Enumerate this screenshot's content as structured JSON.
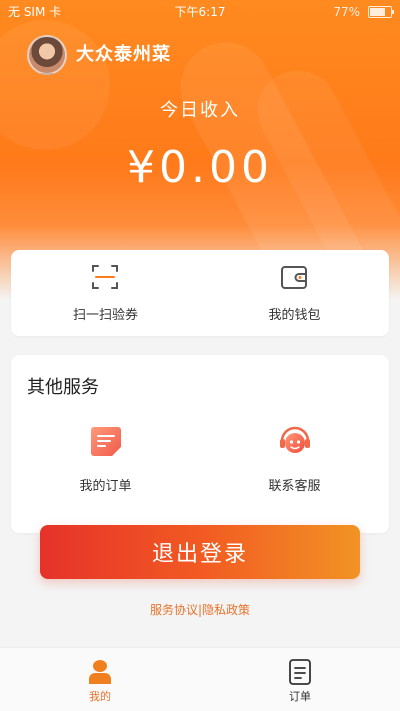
{
  "status_bar": {
    "carrier": "无 SIM 卡",
    "time": "下午6:17",
    "battery": "77%",
    "battery_level": 0.77
  },
  "header": {
    "shop_name": "大众泰州菜",
    "income_label": "今日收入",
    "income_amount": "¥0.00"
  },
  "quick_actions": [
    {
      "label": "扫一扫验券",
      "icon": "scan-icon"
    },
    {
      "label": "我的钱包",
      "icon": "wallet-icon"
    }
  ],
  "services": {
    "title": "其他服务",
    "items": [
      {
        "label": "我的订单",
        "icon": "order-icon"
      },
      {
        "label": "联系客服",
        "icon": "customer-service-icon"
      }
    ]
  },
  "logout_label": "退出登录",
  "links": {
    "agreement": "服务协议",
    "separator": "|",
    "privacy": "隐私政策"
  },
  "tabbar": [
    {
      "label": "我的",
      "icon": "profile-icon",
      "active": true
    },
    {
      "label": "订单",
      "icon": "orders-tab-icon",
      "active": false
    }
  ],
  "colors": {
    "brand": "#ff7a1a",
    "active_tab": "#e8732a",
    "inactive_tab": "#333333"
  }
}
